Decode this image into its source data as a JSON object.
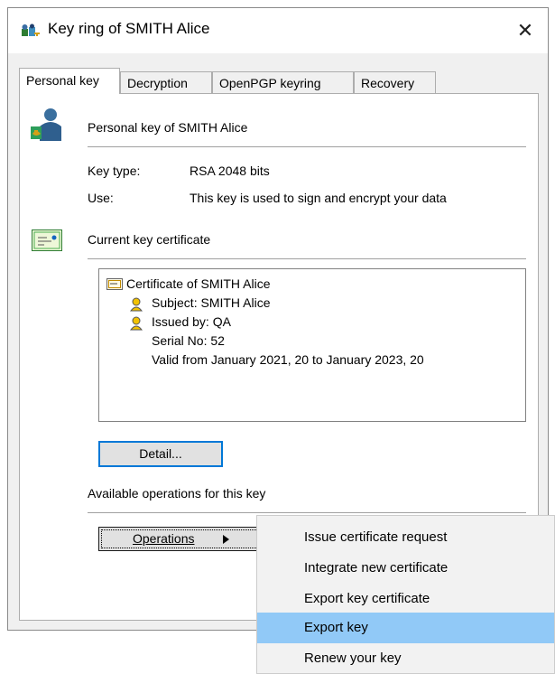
{
  "window": {
    "title": "Key ring of SMITH Alice",
    "close_glyph": "✕"
  },
  "tabs": [
    {
      "label": "Personal key",
      "active": true
    },
    {
      "label": "Decryption",
      "active": false
    },
    {
      "label": "OpenPGP keyring",
      "active": false
    },
    {
      "label": "Recovery",
      "active": false
    }
  ],
  "personal_key": {
    "heading": "Personal key of SMITH Alice",
    "key_type_label": "Key type:",
    "key_type_value": "RSA 2048 bits",
    "use_label": "Use:",
    "use_value": "This key is used to sign and encrypt your data"
  },
  "certificate": {
    "heading": "Current key certificate",
    "tree": {
      "root": "Certificate of SMITH Alice",
      "subject": "Subject: SMITH Alice",
      "issued_by": "Issued by: QA",
      "serial": "Serial No: 52",
      "validity": "Valid from January 2021, 20 to January 2023, 20"
    },
    "detail_button": "Detail..."
  },
  "operations": {
    "heading": "Available operations for this key",
    "button_label": "Operations",
    "menu_items": [
      {
        "label": "Issue certificate request",
        "highlighted": false
      },
      {
        "label": "Integrate new certificate",
        "highlighted": false
      },
      {
        "label": "Export key certificate",
        "highlighted": false
      },
      {
        "label": "Export key",
        "highlighted": true
      },
      {
        "label": "Renew your key",
        "highlighted": false
      }
    ]
  },
  "colors": {
    "highlight": "#91c9f7",
    "focus_border": "#0078d7",
    "dialog_bg": "#f0f0f0"
  }
}
